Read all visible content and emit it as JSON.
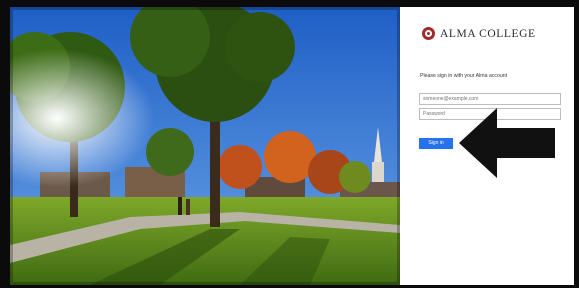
{
  "page": {
    "background_color": "#0b0b0b",
    "panel_color": "#ffffff"
  },
  "brand": {
    "name": "ALMA COLLEGE",
    "seal_color": "#9e2a2b"
  },
  "signin": {
    "prompt": "Please sign in with your Alma account",
    "email_placeholder": "someone@example.com",
    "password_placeholder": "Password",
    "button_label": "Sign in",
    "button_color": "#2672ec"
  },
  "annotation": {
    "icon": "left-arrow-icon",
    "color": "#111111"
  }
}
